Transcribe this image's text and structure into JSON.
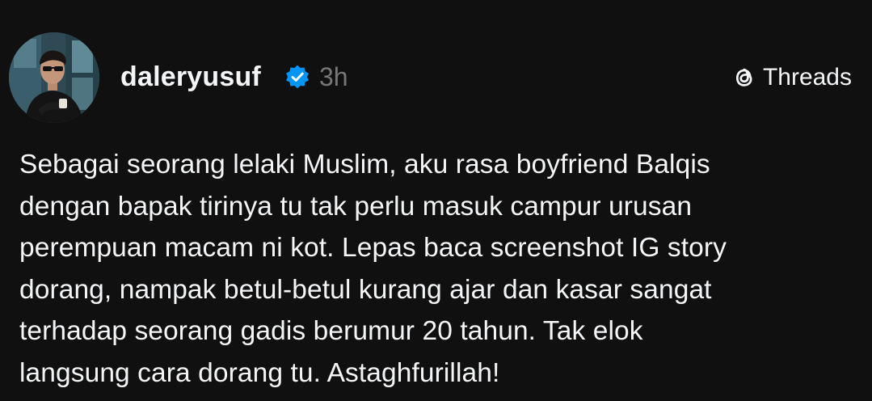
{
  "post": {
    "author": {
      "username": "daleryusuf",
      "verified": true,
      "avatar_icon": "profile-photo"
    },
    "timestamp": "3h",
    "platform": {
      "label": "Threads",
      "icon": "threads-logo-icon"
    },
    "text": "Sebagai seorang lelaki Muslim, aku rasa boyfriend Balqis\ndengan bapak tirinya tu tak perlu masuk campur urusan\nperempuan macam ni kot. Lepas baca screenshot IG story\ndorang, nampak betul-betul kurang ajar dan kasar sangat\nterhadap seorang gadis berumur 20 tahun. Tak elok\nlangsung cara dorang tu. Astaghfurillah!"
  },
  "colors": {
    "background": "#101010",
    "text": "#f3f5f7",
    "muted": "#777777",
    "verified_badge": "#0095f6"
  }
}
